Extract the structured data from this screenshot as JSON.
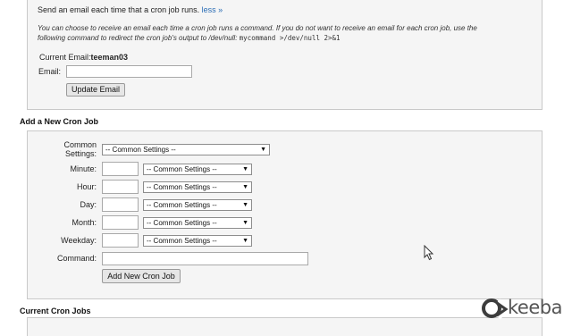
{
  "email_section": {
    "intro_text": "Send an email each time that a cron job runs.",
    "less_link": "less »",
    "note_line1": "You can choose to receive an email each time a cron job runs a command. If you do not want to receive an email for each cron job, use the",
    "note_line2": "following command to redirect the cron job's output to /dev/null:",
    "note_command": "mycommand >/dev/null 2>&1",
    "current_email_label": "Current Email:",
    "current_email_value": "teeman03",
    "email_label": "Email:",
    "email_value": "",
    "update_button": "Update Email"
  },
  "add_cron": {
    "title": "Add a New Cron Job",
    "common_settings_label_1": "Common",
    "common_settings_label_2": "Settings:",
    "common_settings_select": "-- Common Settings --",
    "fields": [
      {
        "label": "Minute:",
        "value": "",
        "select": "-- Common Settings --"
      },
      {
        "label": "Hour:",
        "value": "",
        "select": "-- Common Settings --"
      },
      {
        "label": "Day:",
        "value": "",
        "select": "-- Common Settings --"
      },
      {
        "label": "Month:",
        "value": "",
        "select": "-- Common Settings --"
      },
      {
        "label": "Weekday:",
        "value": "",
        "select": "-- Common Settings --"
      }
    ],
    "command_label": "Command:",
    "command_value": "",
    "add_button": "Add New Cron Job"
  },
  "current_jobs": {
    "title": "Current Cron Jobs"
  },
  "watermark": {
    "brand_text": "keeba",
    "brand_color": "#555555",
    "accent_color": "#3d3d3d"
  }
}
